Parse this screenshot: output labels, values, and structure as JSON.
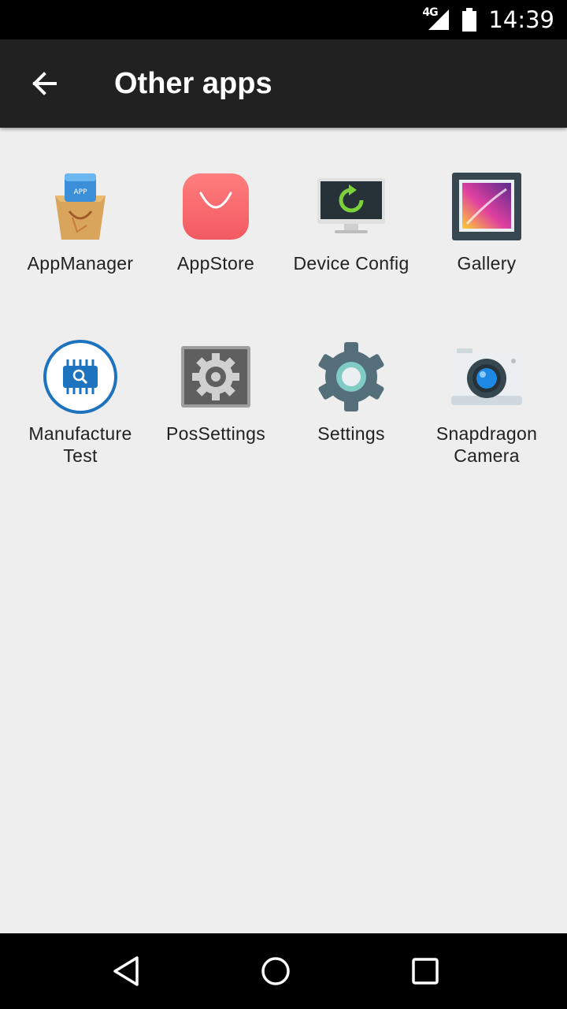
{
  "status_bar": {
    "network": "4G",
    "time": "14:39"
  },
  "app_bar": {
    "title": "Other apps"
  },
  "apps": [
    {
      "label": "AppManager",
      "icon": "app-manager-icon"
    },
    {
      "label": "AppStore",
      "icon": "app-store-icon"
    },
    {
      "label": "Device Config",
      "icon": "device-config-icon"
    },
    {
      "label": "Gallery",
      "icon": "gallery-icon"
    },
    {
      "label": "Manufacture\nTest",
      "icon": "manufacture-test-icon"
    },
    {
      "label": "PosSettings",
      "icon": "pos-settings-icon"
    },
    {
      "label": "Settings",
      "icon": "settings-icon"
    },
    {
      "label": "Snapdragon\nCamera",
      "icon": "camera-icon"
    }
  ]
}
